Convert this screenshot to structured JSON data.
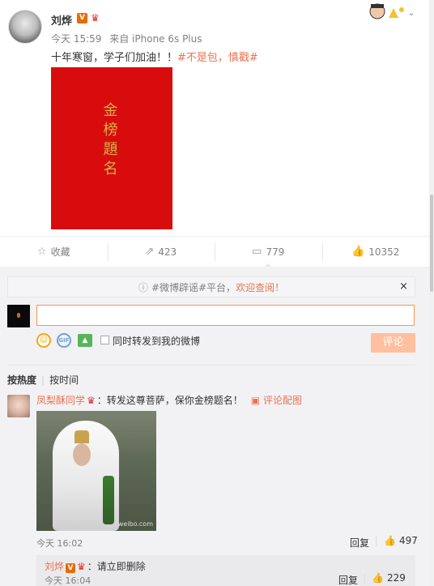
{
  "post": {
    "author": "刘烨",
    "verified_badge": "V",
    "crown_icon": "crown-icon",
    "time": "今天 15:59",
    "source": "来自 iPhone 6s Plus",
    "text_plain": "十年寒窗，学子们加油！！",
    "text_tag": "#不是包，慎戳#",
    "poster_title": "金榜題名",
    "chevron": "⌄"
  },
  "actions": {
    "favorite": "收藏",
    "repost": "423",
    "comment": "779",
    "like": "10352"
  },
  "comments": {
    "notice_prefix": "#微博辟谣#平台，",
    "notice_highlight": "欢迎查阅！",
    "notice_close": "×",
    "input_value": "",
    "repost_label": "同时转发到我的微博",
    "submit_label": "评论",
    "sort_hot": "按热度",
    "sort_time": "按时间",
    "item": {
      "author": "凤梨酥同学",
      "text": "：转发这尊菩萨，保你金榜题名！",
      "pic_link": "评论配图",
      "image_watermark": "weibo.com",
      "time": "今天 16:02",
      "reply": "回复",
      "likes": "497"
    },
    "sub": {
      "author": "刘烨",
      "verified_badge": "V",
      "text": "：请立即删除",
      "time": "今天 16:04",
      "reply": "回复",
      "likes": "229"
    }
  },
  "colors": {
    "accent": "#eb7350",
    "poster_red": "#d80c0c",
    "submit_disabled": "#ffc09f"
  }
}
